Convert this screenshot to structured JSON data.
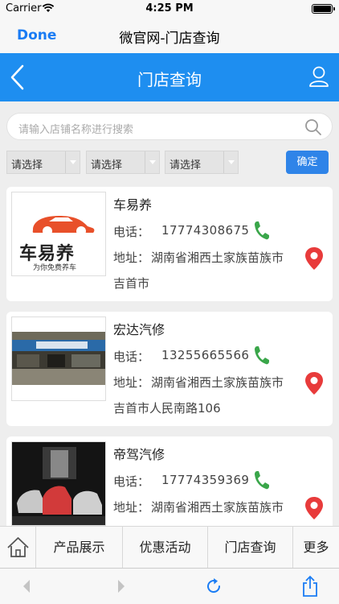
{
  "status_bar": {
    "carrier": "Carrier",
    "time": "4:25 PM"
  },
  "browser_nav": {
    "done_label": "Done",
    "title": "微官网-门店查询"
  },
  "header": {
    "title": "门店查询"
  },
  "search": {
    "placeholder": "请输入店铺名称进行搜索"
  },
  "filters": [
    {
      "value": "请选择"
    },
    {
      "value": "请选择"
    },
    {
      "value": "请选择"
    }
  ],
  "confirm_label": "确定",
  "labels": {
    "phone": "电话：",
    "address": "地址："
  },
  "stores": [
    {
      "name": "车易养",
      "phone": "17774308675",
      "address_line1": "湖南省湘西土家族苗族市",
      "address_line2": "吉首市",
      "logo_text": "车易养",
      "logo_slogan": "为你免费养车"
    },
    {
      "name": "宏达汽修",
      "phone": "13255665566",
      "address_line1": "湖南省湘西土家族苗族市",
      "address_line2": "吉首市人民南路106"
    },
    {
      "name": "帝驾汽修",
      "phone": "17774359369",
      "address_line1": "湖南省湘西土家族苗族市",
      "address_line2": ""
    }
  ],
  "tabbar": {
    "items": [
      "产品展示",
      "优惠活动",
      "门店查询",
      "更多"
    ]
  },
  "colors": {
    "accent": "#1e8ef0",
    "button": "#2f84e8",
    "call_green": "#3aa64a",
    "pin_red": "#e83b3b"
  }
}
